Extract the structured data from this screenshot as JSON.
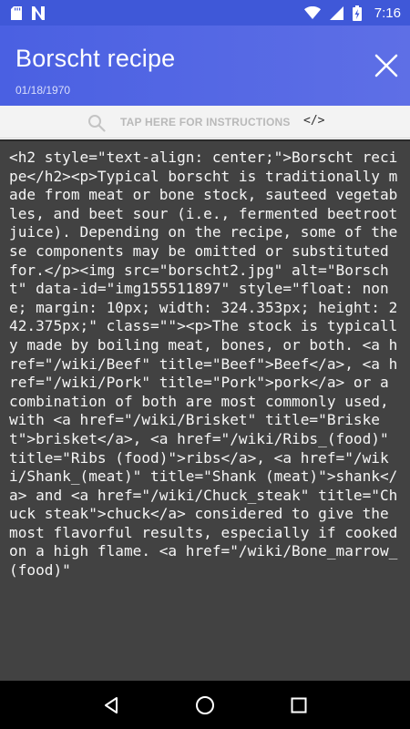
{
  "status_bar": {
    "time": "7:16",
    "icons": [
      "sd-card-icon",
      "n-notification-icon",
      "wifi-icon",
      "signal-icon",
      "battery-charging-icon"
    ]
  },
  "app_bar": {
    "title": "Borscht recipe",
    "date": "01/18/1970",
    "close_icon": "close-icon"
  },
  "instructions_bar": {
    "label": "TAP HERE FOR INSTRUCTIONS",
    "code_toggle": "</>"
  },
  "editor": {
    "content": "<h2 style=\"text-align: center;\">Borscht recipe</h2><p>Typical borscht is traditionally made from meat or bone stock, sauteed vegetables, and beet sour (i.e., fermented beetroot juice). Depending on the recipe, some of these components may be omitted or substituted for.</p><img src=\"borscht2.jpg\" alt=\"Borscht\" data-id=\"img155511897\" style=\"float: none; margin: 10px; width: 324.353px; height: 242.375px;\" class=\"\"><p>The stock is typically made by boiling meat, bones, or both. <a href=\"/wiki/Beef\" title=\"Beef\">Beef</a>, <a href=\"/wiki/Pork\" title=\"Pork\">pork</a> or a combination of both are most commonly used, with <a href=\"/wiki/Brisket\" title=\"Brisket\">brisket</a>, <a href=\"/wiki/Ribs_(food)\" title=\"Ribs (food)\">ribs</a>, <a href=\"/wiki/Shank_(meat)\" title=\"Shank (meat)\">shank</a> and <a href=\"/wiki/Chuck_steak\" title=\"Chuck steak\">chuck</a> considered to give the most flavorful results, especially if cooked on a high flame. <a href=\"/wiki/Bone_marrow_(food)\""
  },
  "nav_bar": {
    "buttons": [
      "back-icon",
      "home-icon",
      "recents-icon"
    ]
  },
  "colors": {
    "status_bar": "#3f58d8",
    "app_bar": "#4a60e2",
    "editor_bg": "#424242",
    "nav_bar": "#000000"
  }
}
